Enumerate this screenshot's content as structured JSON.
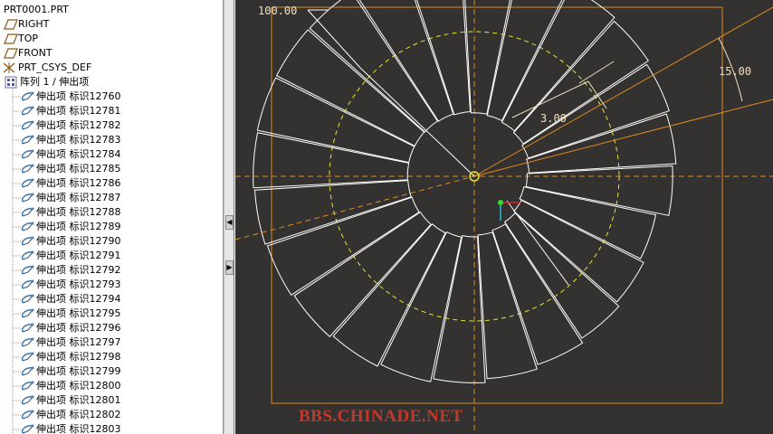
{
  "tree": {
    "root": "PRT0001.PRT",
    "datum_planes": [
      "RIGHT",
      "TOP",
      "FRONT"
    ],
    "csys": "PRT_CSYS_DEF",
    "pattern": "阵列 1 / 伸出项",
    "features": [
      "伸出项 标识12760",
      "伸出项 标识12781",
      "伸出项 标识12782",
      "伸出项 标识12783",
      "伸出项 标识12784",
      "伸出项 标识12785",
      "伸出项 标识12786",
      "伸出项 标识12787",
      "伸出项 标识12788",
      "伸出项 标识12789",
      "伸出项 标识12790",
      "伸出项 标识12791",
      "伸出项 标识12792",
      "伸出项 标识12793",
      "伸出项 标识12794",
      "伸出项 标识12795",
      "伸出项 标识12796",
      "伸出项 标识12797",
      "伸出项 标识12798",
      "伸出项 标识12799",
      "伸出项 标识12800",
      "伸出项 标识12801",
      "伸出项 标识12802",
      "伸出项 标识12803"
    ]
  },
  "sash": {
    "collapse_glyph": "◀",
    "expand_glyph": "▶"
  },
  "viewport": {
    "dimensions": {
      "outer_diameter": "100.00",
      "angle": "15.00",
      "height": "3.00"
    },
    "pattern_count": 24,
    "colors": {
      "background": "#333230",
      "geometry": "#ffffff",
      "datum": "#e08a1e",
      "sketch_circle": "#e6e62a",
      "dimension": "#f0e0c0"
    }
  },
  "watermark": "BBS.CHINADE.NET"
}
